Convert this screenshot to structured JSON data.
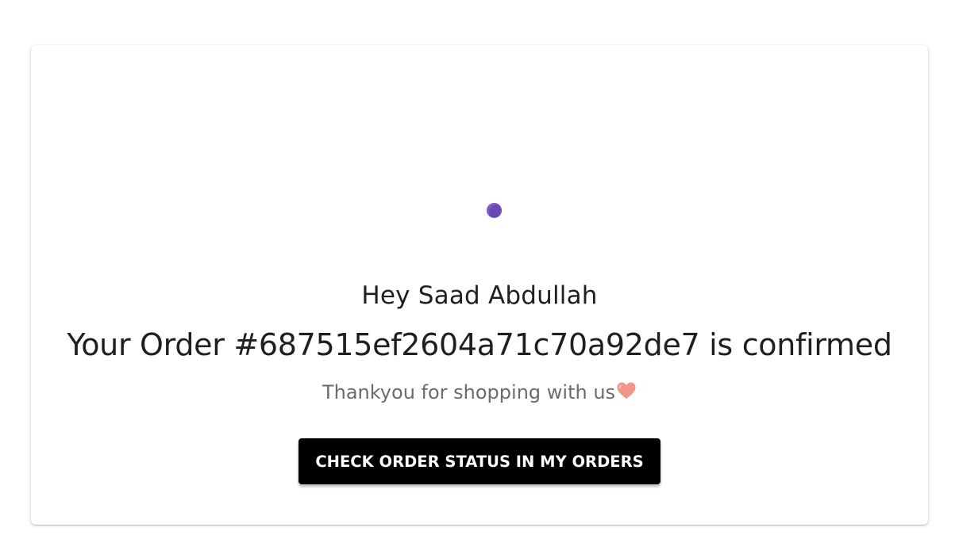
{
  "confirmation": {
    "greeting": "Hey Saad Abdullah",
    "order_message": "Your Order #687515ef2604a71c70a92de7 is confirmed",
    "thanks_text": "Thankyou for shopping with us",
    "heart_icon": "heart-icon",
    "button_label": "CHECK ORDER STATUS IN MY ORDERS"
  },
  "colors": {
    "button_bg": "#000000",
    "button_text": "#ffffff",
    "dot": "#6d47b3",
    "heart": "#f0958a",
    "muted_text": "#6b6b6b"
  }
}
